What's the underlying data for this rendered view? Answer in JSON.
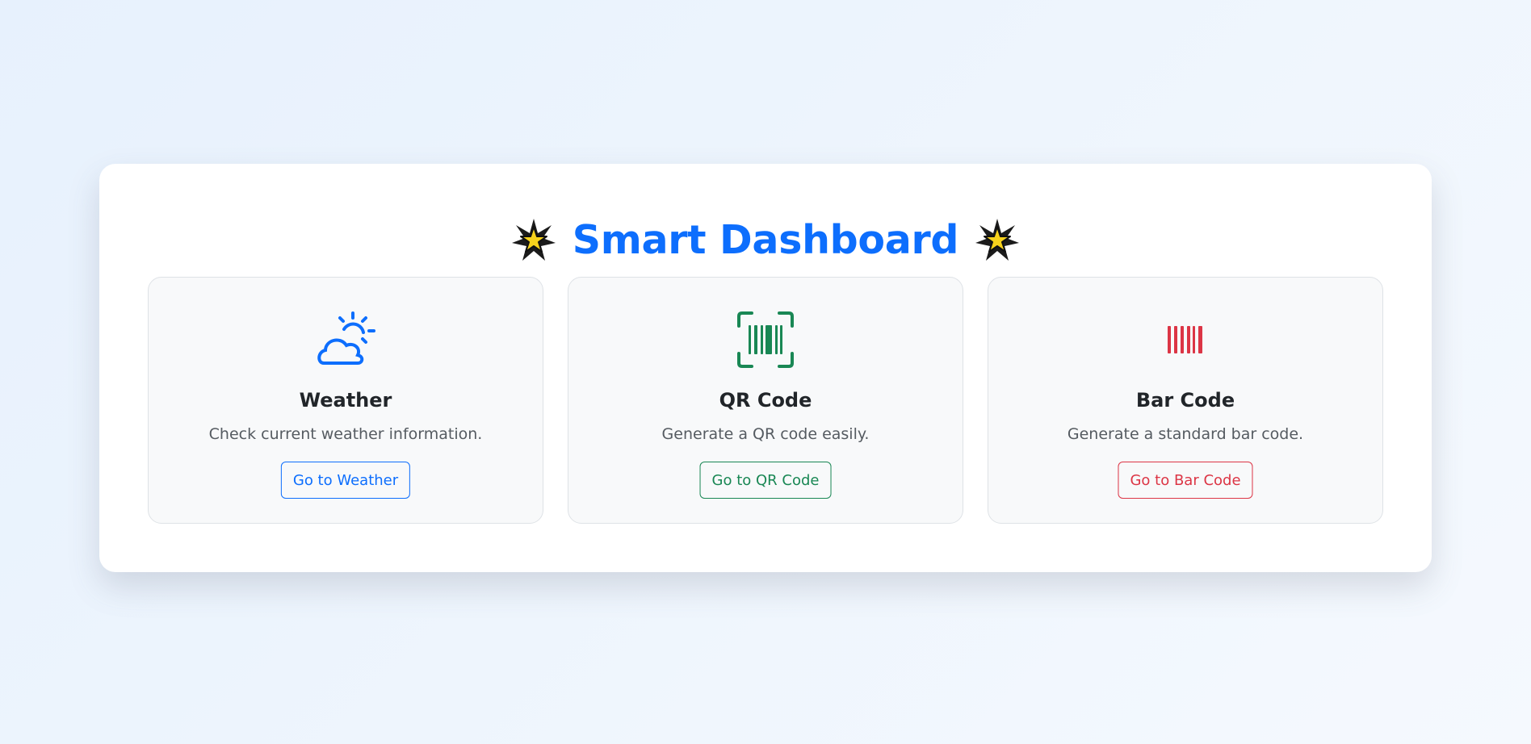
{
  "page": {
    "title": "Smart Dashboard",
    "title_icon": "star-icon"
  },
  "cards": [
    {
      "icon": "cloud-sun-icon",
      "color": "#0d6efd",
      "title": "Weather",
      "description": "Check current weather information.",
      "button_label": "Go to Weather"
    },
    {
      "icon": "qr-code-scan-icon",
      "color": "#198754",
      "title": "QR Code",
      "description": "Generate a QR code easily.",
      "button_label": "Go to QR Code"
    },
    {
      "icon": "barcode-icon",
      "color": "#dc3545",
      "title": "Bar Code",
      "description": "Generate a standard bar code.",
      "button_label": "Go to Bar Code"
    }
  ],
  "colors": {
    "primary": "#0d6efd",
    "success": "#198754",
    "danger": "#dc3545"
  }
}
